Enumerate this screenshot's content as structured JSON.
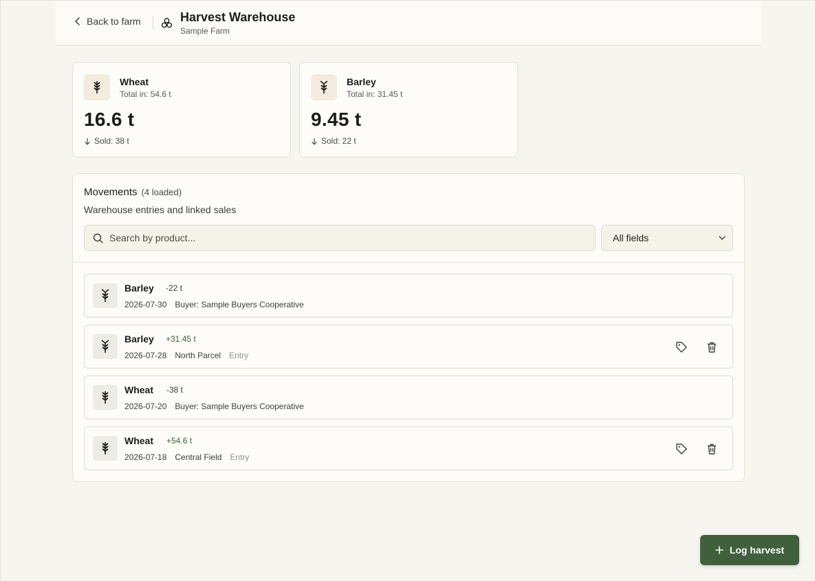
{
  "header": {
    "back_label": "Back to farm",
    "title": "Harvest Warehouse",
    "subtitle": "Sample Farm"
  },
  "stock": [
    {
      "name": "Wheat",
      "total": "Total in: 54.6 t",
      "quantity": "16.6 t",
      "sold": "Sold: 38 t",
      "icon": "wheat-icon"
    },
    {
      "name": "Barley",
      "total": "Total in: 31.45 t",
      "quantity": "9.45 t",
      "sold": "Sold: 22 t",
      "icon": "barley-icon"
    }
  ],
  "movements": {
    "title": "Movements",
    "count": "(4 loaded)",
    "description": "Warehouse entries and linked sales",
    "search_placeholder": "Search by product...",
    "filter_selected": "All fields",
    "rows": [
      {
        "name": "Barley",
        "delta": "-22 t",
        "date": "2026-07-30",
        "location": "Buyer: Sample Buyers Cooperative",
        "tag": "",
        "icon": "barley-icon"
      },
      {
        "name": "Barley",
        "delta": "+31.45 t",
        "date": "2026-07-28",
        "location": "North Parcel",
        "tag": "Entry",
        "icon": "barley-icon"
      },
      {
        "name": "Wheat",
        "delta": "-38 t",
        "date": "2026-07-20",
        "location": "Buyer: Sample Buyers Cooperative",
        "tag": "",
        "icon": "wheat-icon"
      },
      {
        "name": "Wheat",
        "delta": "+54.6 t",
        "date": "2026-07-18",
        "location": "Central Field",
        "tag": "Entry",
        "icon": "wheat-icon"
      }
    ]
  },
  "fab": {
    "label": "Log harvest"
  },
  "colors": {
    "accent": "#3f5f3d",
    "background": "#f7f5f0",
    "card": "#fdfcf9"
  }
}
